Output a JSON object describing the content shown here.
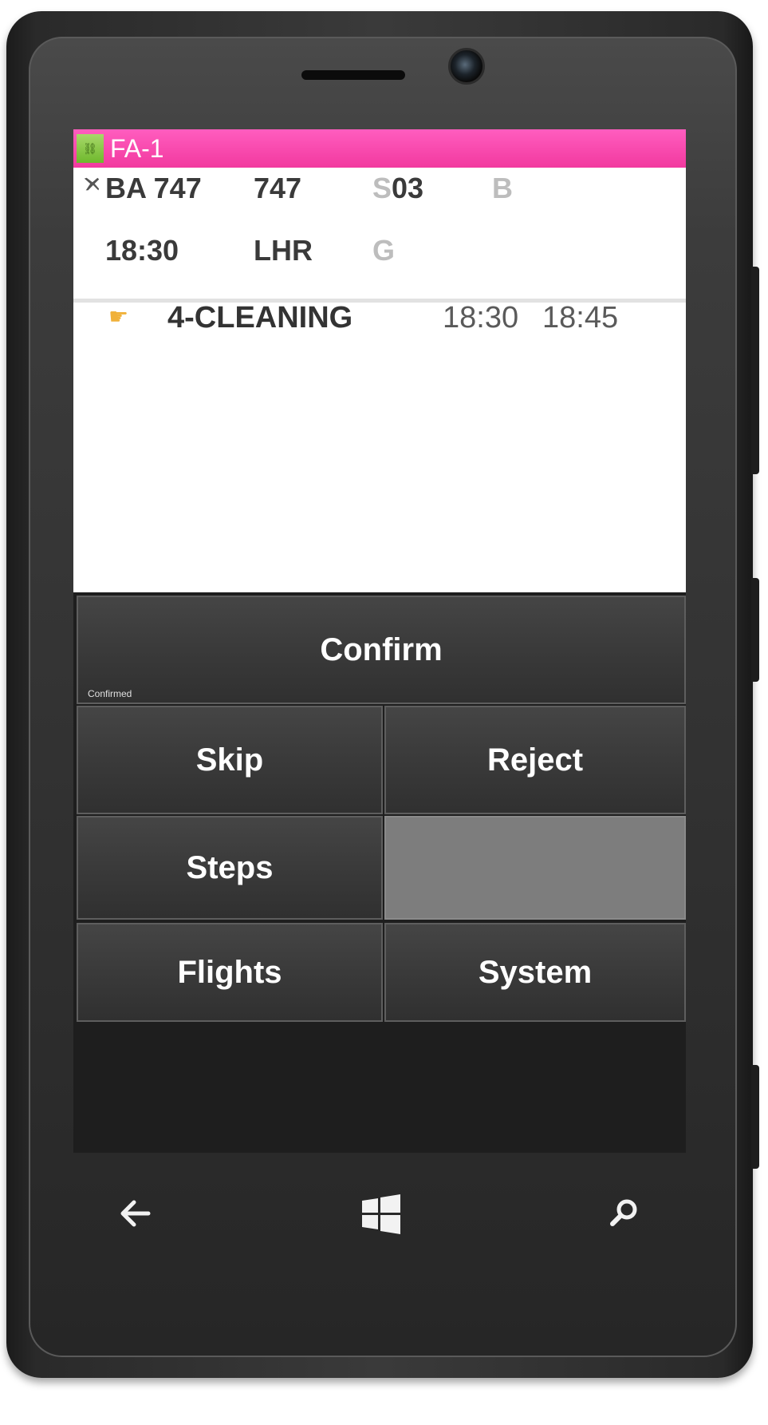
{
  "titlebar": {
    "app_icon": "link-icon",
    "title": "FA-1"
  },
  "flight": {
    "row1": {
      "icon": "plane-icon",
      "flight_no": "BA 747",
      "aircraft": "747",
      "stand_prefix": "S",
      "stand": "03",
      "col4": "B"
    },
    "row2": {
      "time": "18:30",
      "airport": "LHR",
      "col3": "G"
    }
  },
  "task": {
    "icon": "pointing-hand-icon",
    "label": "4-CLEANING",
    "start_time": "18:30",
    "end_time": "18:45"
  },
  "buttons": {
    "confirm": "Confirm",
    "confirm_status": "Confirmed",
    "skip": "Skip",
    "reject": "Reject",
    "steps": "Steps",
    "flights": "Flights",
    "system": "System"
  },
  "navbar": {
    "back_icon": "back-arrow-icon",
    "home_icon": "windows-logo-icon",
    "search_icon": "search-icon"
  },
  "colors": {
    "titlebar": "#f2399f",
    "button": "#3a3a3a",
    "empty_tile": "#7d7d7d"
  }
}
